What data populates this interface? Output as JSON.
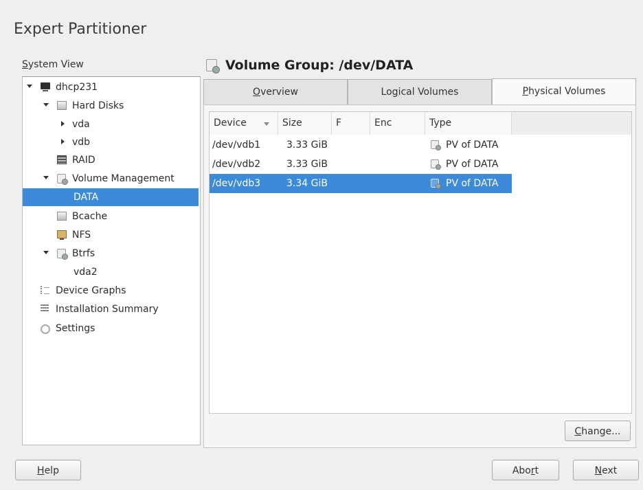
{
  "window": {
    "title": "Expert Partitioner"
  },
  "system_view": {
    "label_accel": "S",
    "label_rest": "ystem View",
    "tree": [
      {
        "label": "dhcp231",
        "icon": "computer-icon"
      },
      {
        "label": "Hard Disks",
        "icon": "hard-disk-icon"
      },
      {
        "label": "vda"
      },
      {
        "label": "vdb"
      },
      {
        "label": "RAID",
        "icon": "raid-icon"
      },
      {
        "label": "Volume Management",
        "icon": "volume-icon"
      },
      {
        "label": "DATA",
        "selected": true
      },
      {
        "label": "Bcache",
        "icon": "hard-disk-icon"
      },
      {
        "label": "NFS",
        "icon": "nfs-icon"
      },
      {
        "label": "Btrfs",
        "icon": "volume-icon"
      },
      {
        "label": "vda2"
      },
      {
        "label": "Device Graphs",
        "icon": "graph-icon"
      },
      {
        "label": "Installation Summary",
        "icon": "list-icon"
      },
      {
        "label": "Settings",
        "icon": "gear-icon"
      }
    ]
  },
  "main": {
    "heading": "Volume Group: /dev/DATA",
    "tabs": [
      {
        "accel": "O",
        "rest": "verview"
      },
      {
        "pre": "Lo",
        "accel": "g",
        "rest": "ical Volumes"
      },
      {
        "accel": "P",
        "rest": "hysical Volumes",
        "active": true
      }
    ],
    "table": {
      "columns": [
        "Device",
        "Size",
        "F",
        "Enc",
        "Type"
      ],
      "rows": [
        {
          "device": "/dev/vdb1",
          "size": "3.33 GiB",
          "f": "",
          "enc": "",
          "type": "PV of DATA"
        },
        {
          "device": "/dev/vdb2",
          "size": "3.33 GiB",
          "f": "",
          "enc": "",
          "type": "PV of DATA"
        },
        {
          "device": "/dev/vdb3",
          "size": "3.34 GiB",
          "f": "",
          "enc": "",
          "type": "PV of DATA",
          "selected": true
        }
      ]
    },
    "change_button": {
      "accel": "C",
      "rest": "hange..."
    }
  },
  "footer": {
    "help": {
      "accel": "H",
      "rest": "elp"
    },
    "abort": {
      "pre": "Abo",
      "accel": "r",
      "rest": "t"
    },
    "next": {
      "accel": "N",
      "rest": "ext"
    }
  },
  "colors": {
    "selection": "#3c8ad8",
    "background": "#efefef"
  }
}
